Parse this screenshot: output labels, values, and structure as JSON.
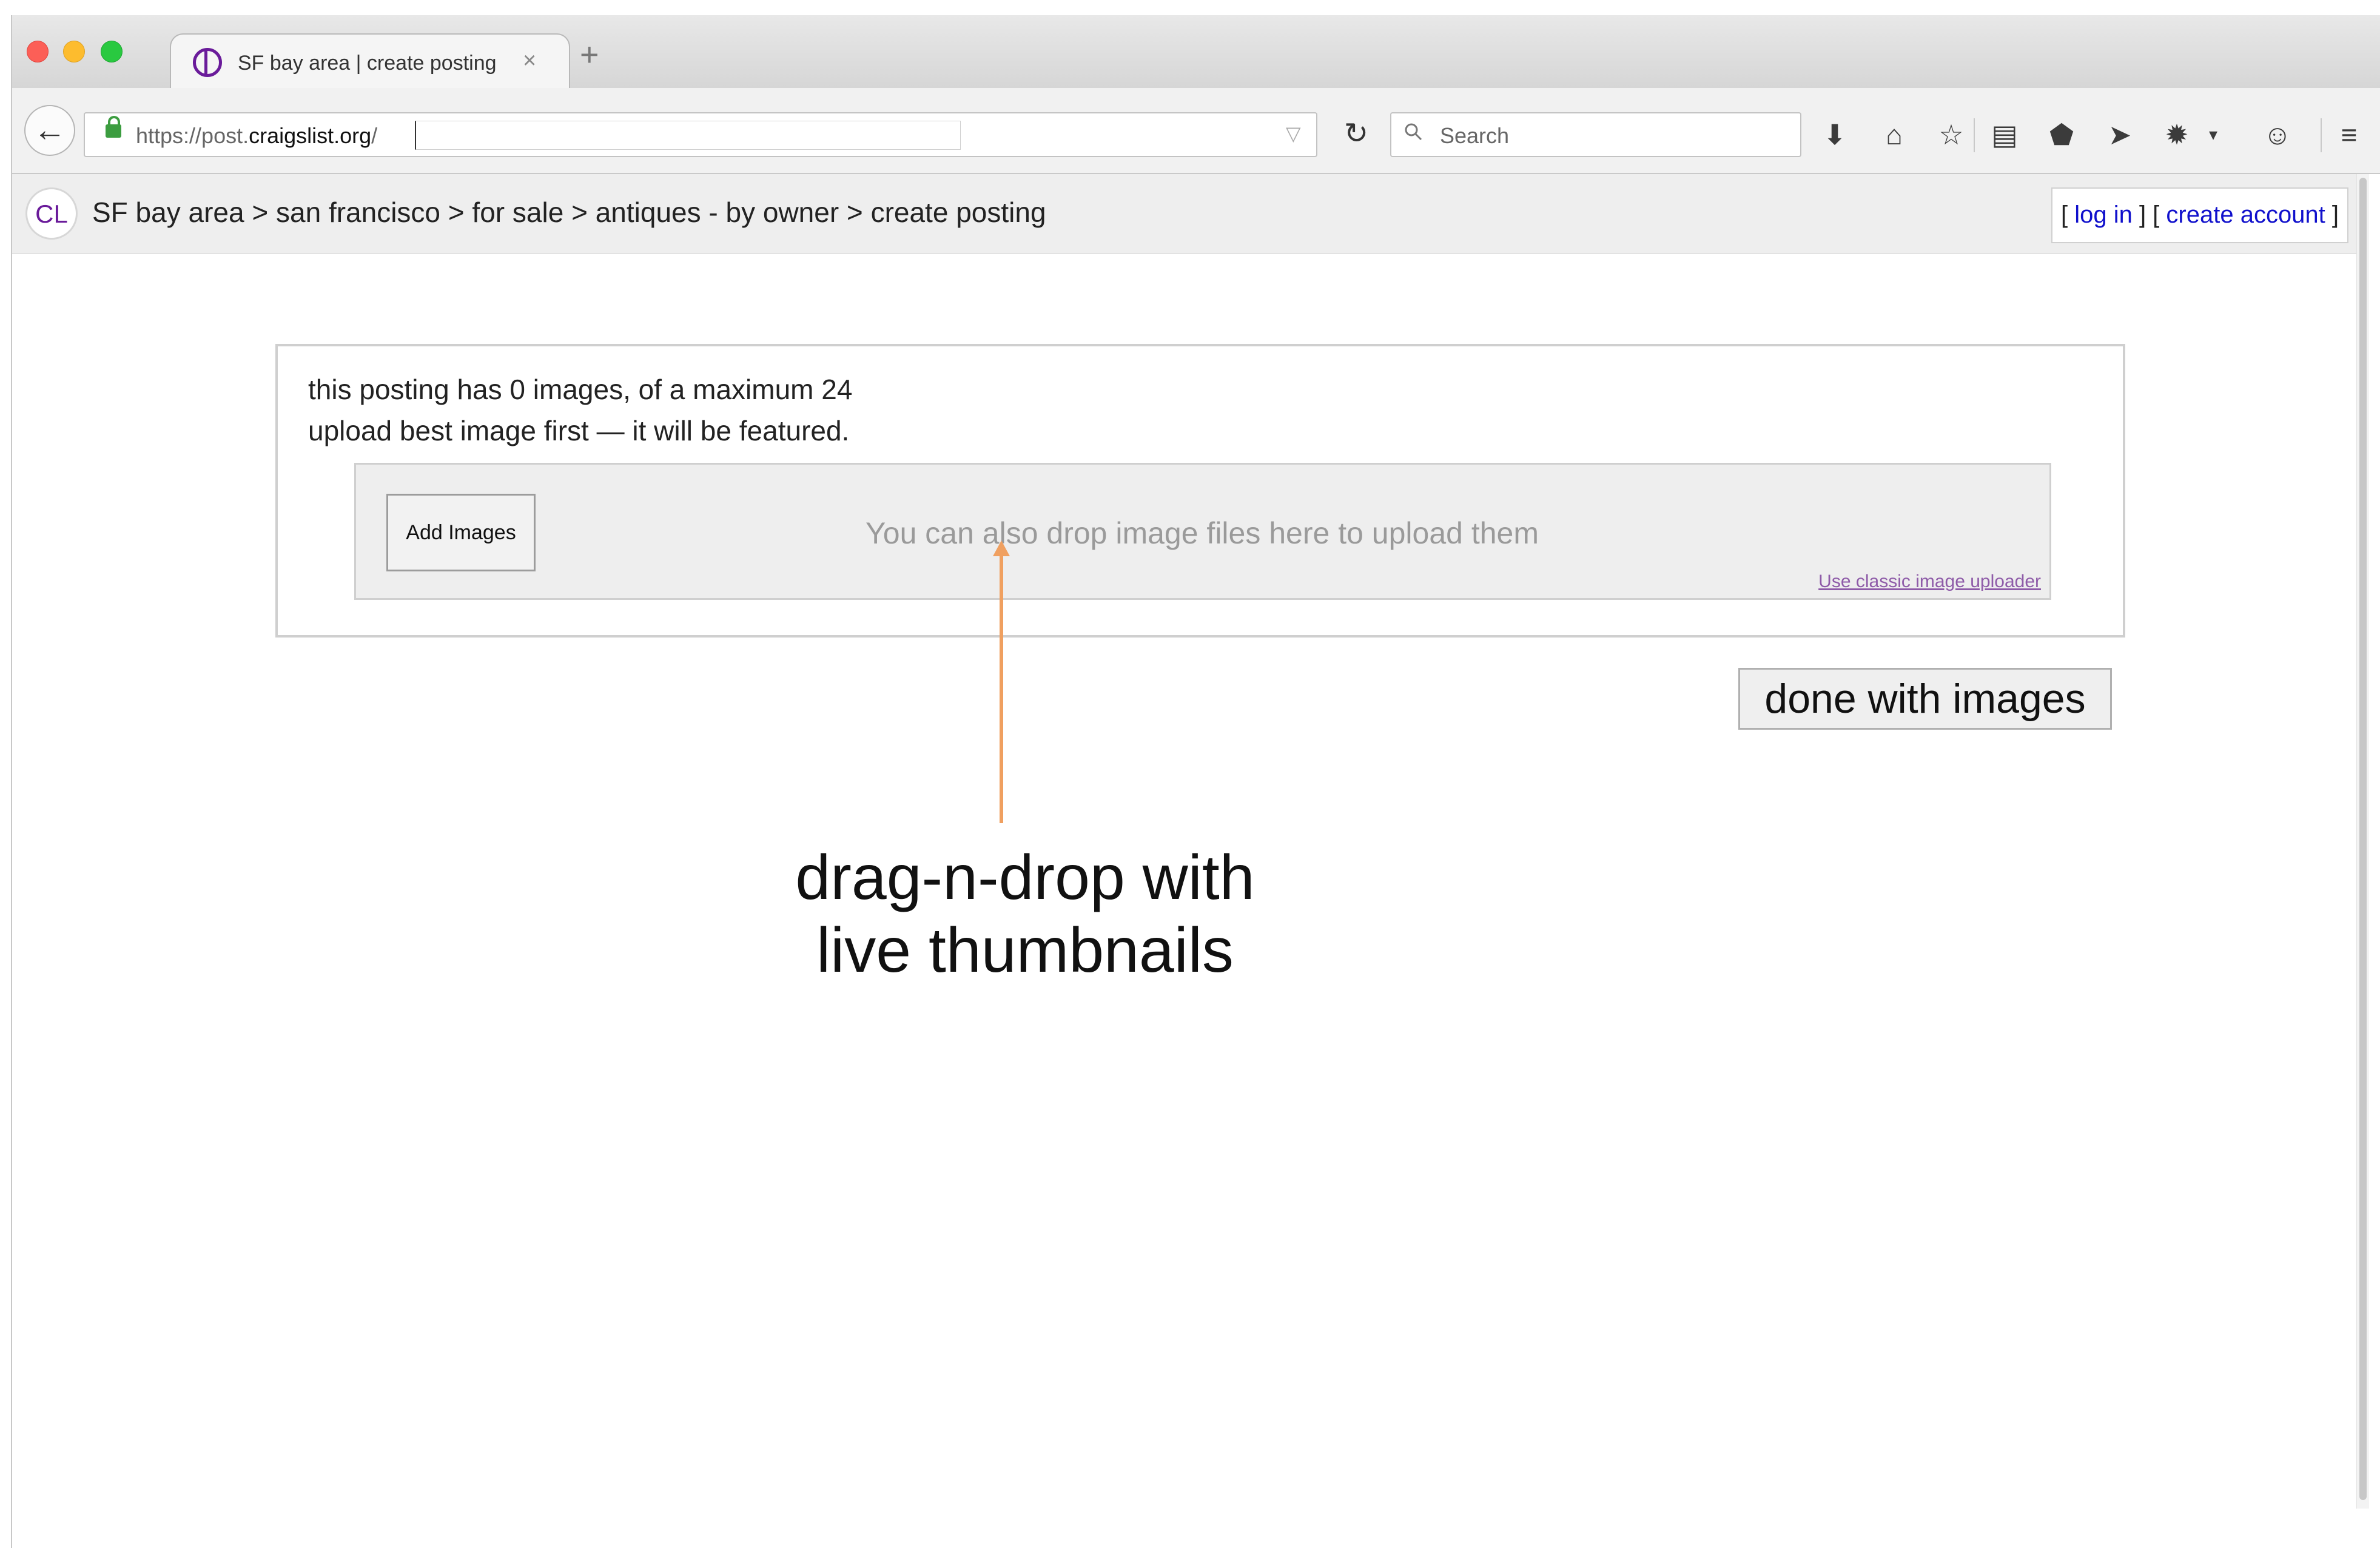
{
  "browser": {
    "tab_title": "SF bay area | create posting",
    "tab_close_glyph": "×",
    "new_tab_glyph": "+",
    "url_prefix": "https://post.",
    "url_domain": "craigslist.org",
    "url_suffix": "/",
    "search_placeholder": "Search",
    "toolbar_icons": [
      "download-icon",
      "home-icon",
      "bookmark-star-icon",
      "reading-list-icon",
      "pocket-icon",
      "send-icon",
      "extension-icon",
      "dropdown-icon",
      "chat-icon",
      "menu-icon"
    ]
  },
  "site": {
    "logo_text": "CL",
    "breadcrumb": "SF bay area > san francisco > for sale > antiques - by owner > create posting",
    "account": {
      "open_bracket_1": "[ ",
      "login_label": "log in",
      "mid_bracket": " ] [ ",
      "create_label": "create account",
      "close_bracket": " ]"
    }
  },
  "upload": {
    "count_text": "this posting has 0 images, of a maximum 24",
    "tip_text": "upload best image first — it will be featured.",
    "add_images_label": "Add Images",
    "drop_hint": "You can also drop image files here to upload them",
    "classic_link": "Use classic image uploader",
    "done_label": "done with images"
  },
  "annotation": {
    "line1": "drag-n-drop with",
    "line2": "live thumbnails"
  },
  "colors": {
    "accent_purple": "#6a1b9a",
    "link_blue": "#1010cc",
    "annotation_orange": "#f0a060",
    "lock_green": "#3c9d40"
  }
}
